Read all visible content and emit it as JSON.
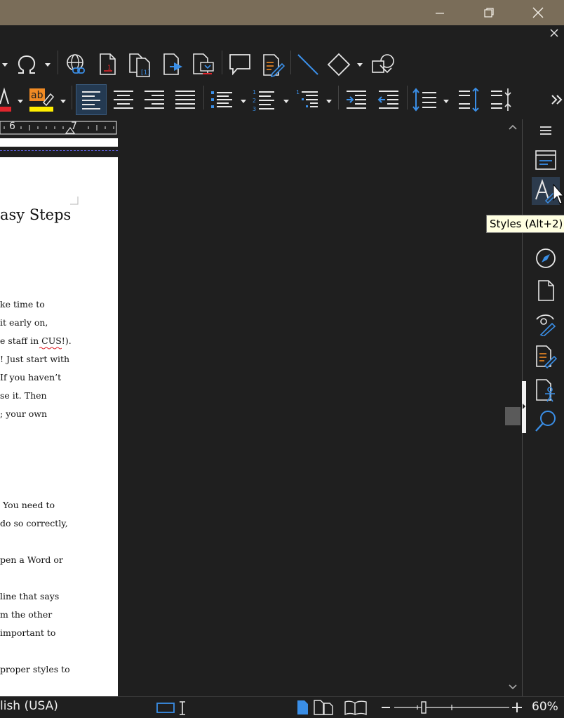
{
  "window": {
    "minimize_icon": "minimize-icon",
    "restore_icon": "restore-icon",
    "close_icon": "close-icon",
    "close_doc_icon": "close-document-icon"
  },
  "document": {
    "title_fragment": "asy Steps",
    "lines": [
      "ke time to",
      "it early on,",
      "e staff in CUS!).",
      "!  Just start with",
      "If you haven’t",
      "se it.  Then",
      "; your own",
      "You need to",
      "do so correctly,",
      "pen a Word or",
      "line that says",
      "m the other",
      "important to",
      "proper styles to"
    ]
  },
  "ruler": {
    "mark_6": "6",
    "mark_7": "7"
  },
  "tooltip": {
    "text": "Styles (Alt+2)"
  },
  "statusbar": {
    "language": "lish (USA)",
    "zoom": "60%",
    "zoom_level": 0.6
  },
  "colors": {
    "titlebar": "#7a6d59",
    "background": "#1f1f1f",
    "accent_blue": "#3a8ee6",
    "font_color_red": "#e0262d",
    "highlight_yellow": "#ffee00",
    "highlight_orange": "#f08a24"
  }
}
